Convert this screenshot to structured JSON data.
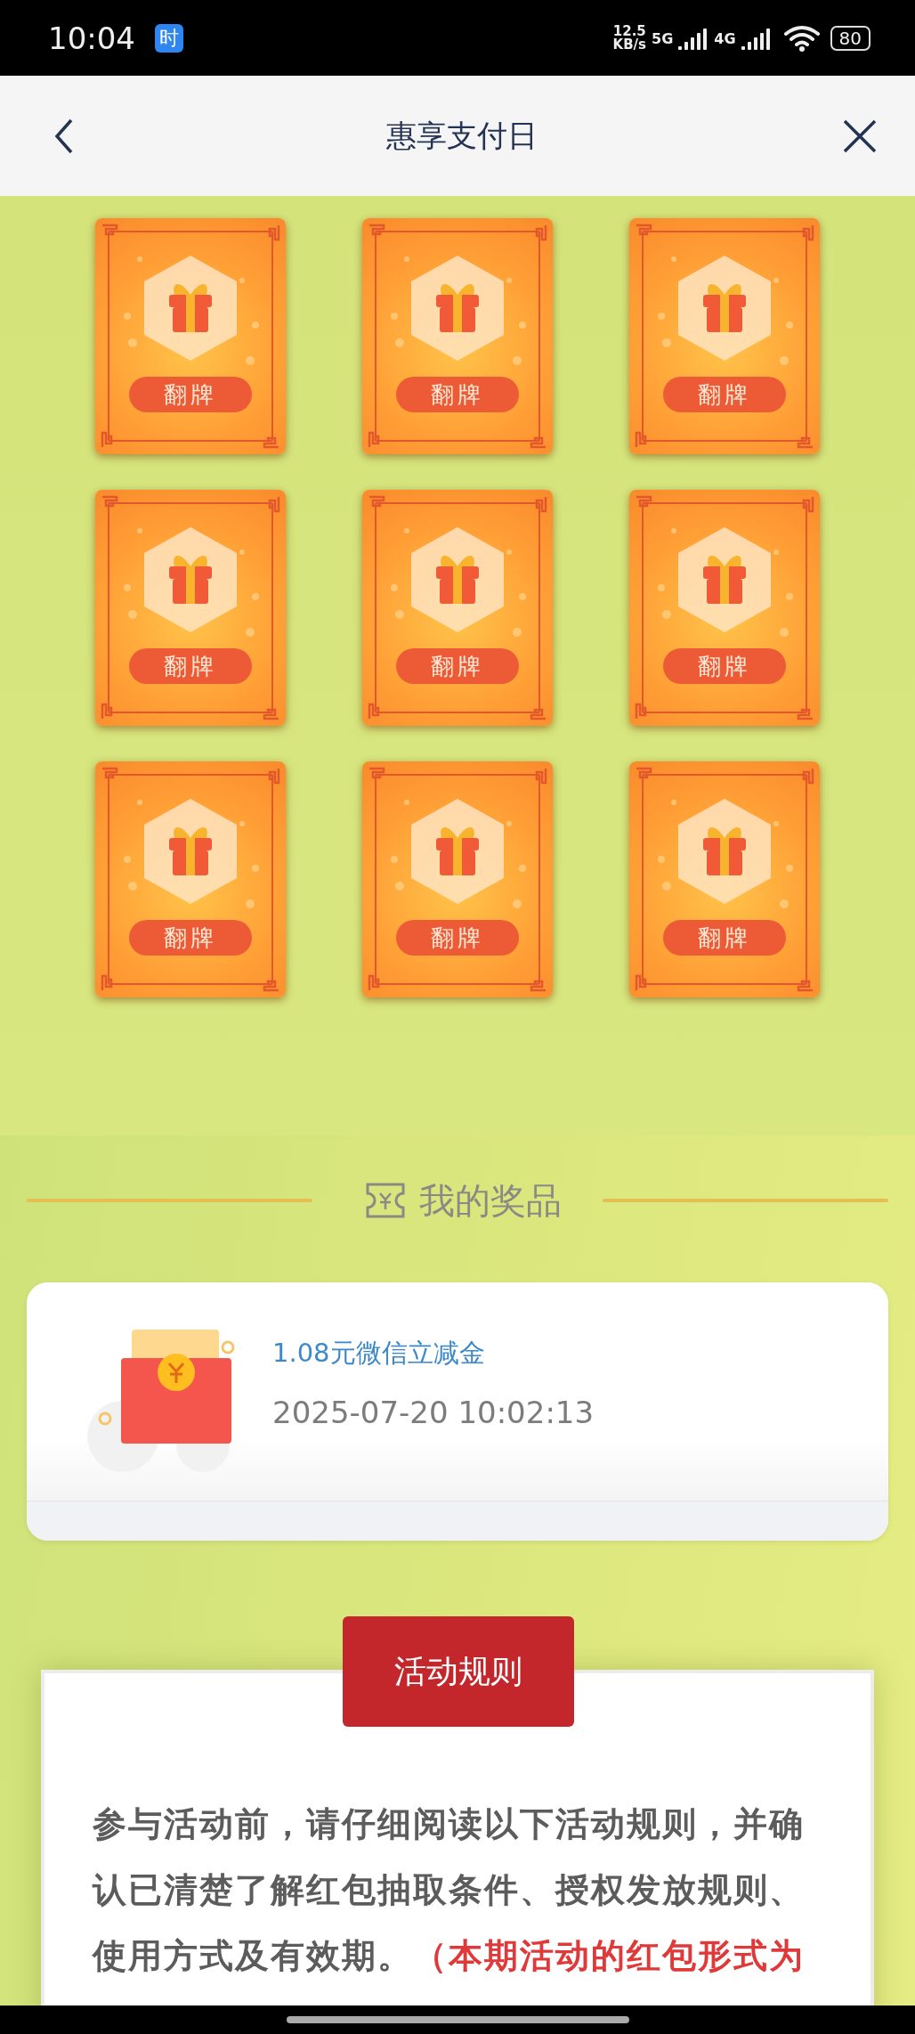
{
  "status_bar": {
    "time": "10:04",
    "app_badge": "时",
    "speed_value": "12.5",
    "speed_unit": "KB/s",
    "networks": [
      "5G",
      "4G"
    ],
    "battery": "80"
  },
  "nav": {
    "title": "惠享支付日"
  },
  "cards": [
    {
      "label": "翻牌"
    },
    {
      "label": "翻牌"
    },
    {
      "label": "翻牌"
    },
    {
      "label": "翻牌"
    },
    {
      "label": "翻牌"
    },
    {
      "label": "翻牌"
    },
    {
      "label": "翻牌"
    },
    {
      "label": "翻牌"
    },
    {
      "label": "翻牌"
    }
  ],
  "prizes": {
    "heading": "我的奖品",
    "items": [
      {
        "name": "1.08元微信立减金",
        "time": "2025-07-20 10:02:13"
      }
    ]
  },
  "rules": {
    "button": "活动规则",
    "paragraph_lines": [
      [
        {
          "text": "参与活动前，请仔细阅读以下活动规则，并确",
          "highlight": false
        }
      ],
      [
        {
          "text": "认已清楚了解红包抽取条件、授权发放规则、",
          "highlight": false
        }
      ],
      [
        {
          "text": "使用方式及有效期。",
          "highlight": false
        },
        {
          "text": "（本期活动的红包形式为",
          "highlight": true
        }
      ]
    ]
  }
}
